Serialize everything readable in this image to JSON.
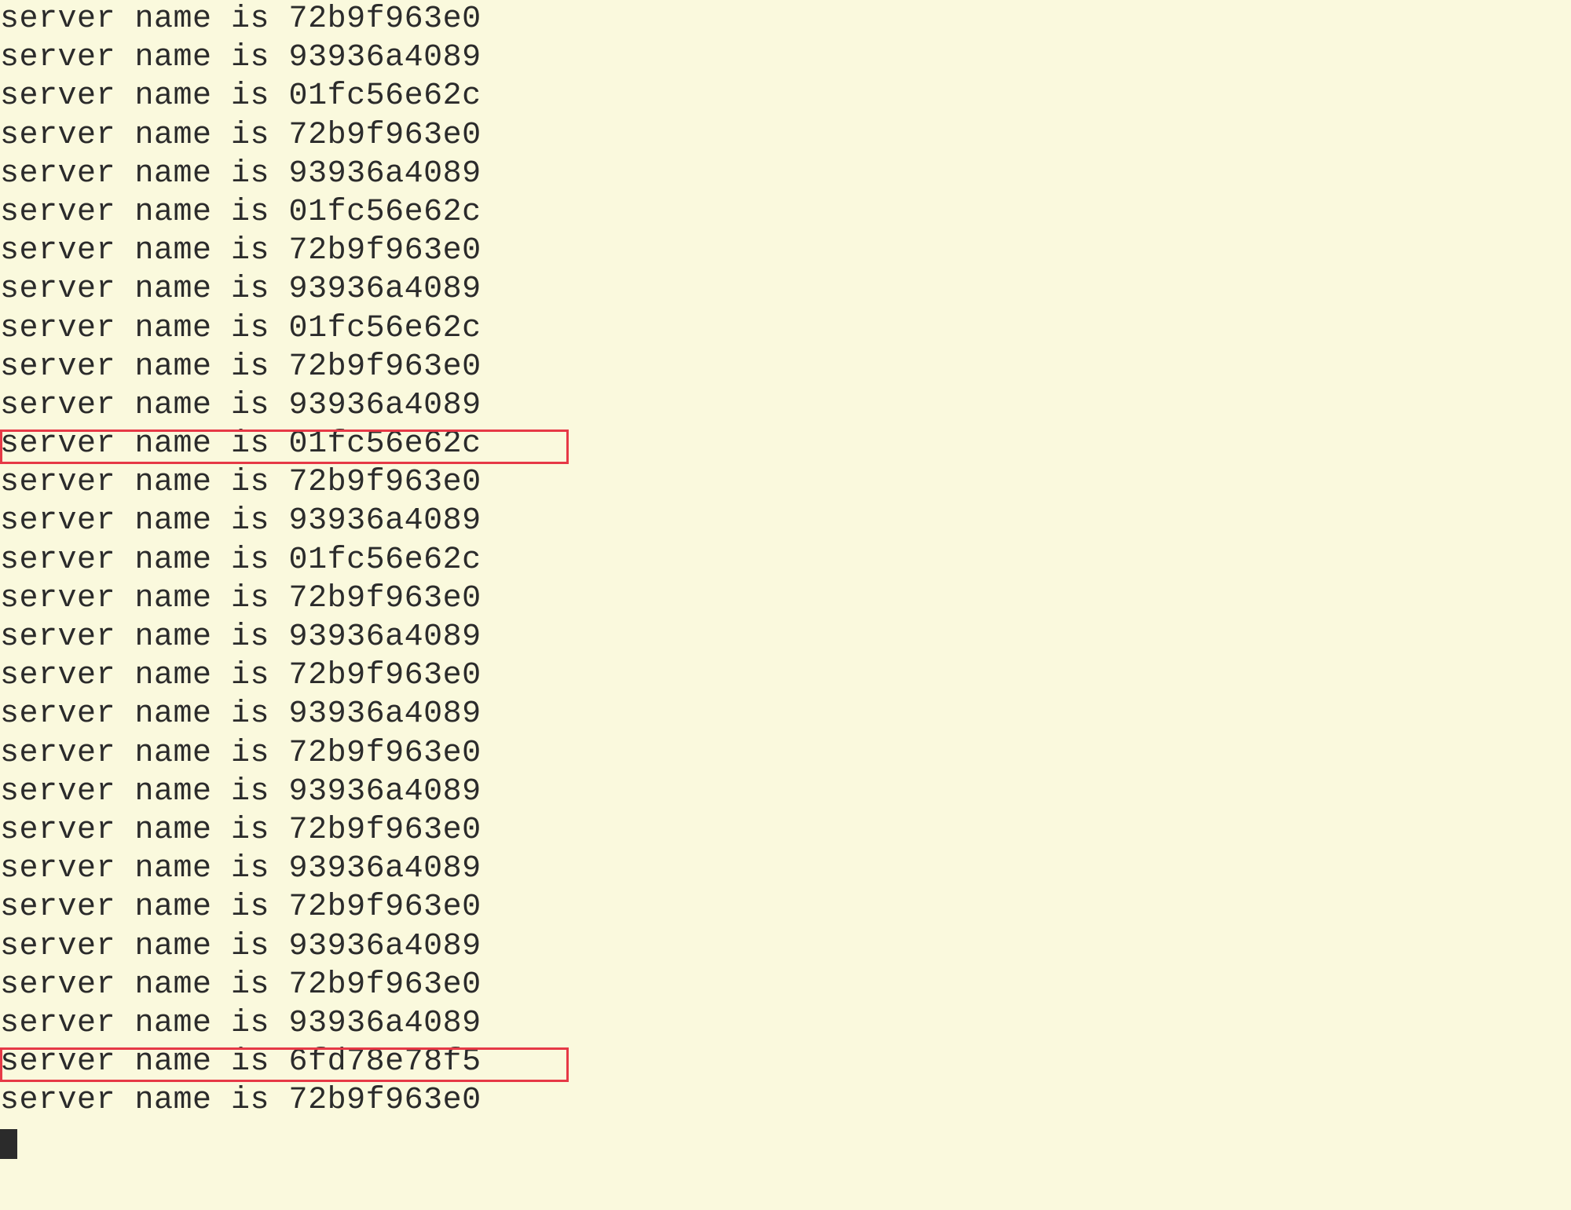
{
  "terminal": {
    "prefix": "server name is ",
    "lines": [
      {
        "id": "72b9f963e0",
        "highlighted": false
      },
      {
        "id": "93936a4089",
        "highlighted": false
      },
      {
        "id": "01fc56e62c",
        "highlighted": false
      },
      {
        "id": "72b9f963e0",
        "highlighted": false
      },
      {
        "id": "93936a4089",
        "highlighted": false
      },
      {
        "id": "01fc56e62c",
        "highlighted": false
      },
      {
        "id": "72b9f963e0",
        "highlighted": false
      },
      {
        "id": "93936a4089",
        "highlighted": false
      },
      {
        "id": "01fc56e62c",
        "highlighted": false
      },
      {
        "id": "72b9f963e0",
        "highlighted": false
      },
      {
        "id": "93936a4089",
        "highlighted": false
      },
      {
        "id": "01fc56e62c",
        "highlighted": true
      },
      {
        "id": "72b9f963e0",
        "highlighted": false
      },
      {
        "id": "93936a4089",
        "highlighted": false
      },
      {
        "id": "01fc56e62c",
        "highlighted": false
      },
      {
        "id": "72b9f963e0",
        "highlighted": false
      },
      {
        "id": "93936a4089",
        "highlighted": false
      },
      {
        "id": "72b9f963e0",
        "highlighted": false
      },
      {
        "id": "93936a4089",
        "highlighted": false
      },
      {
        "id": "72b9f963e0",
        "highlighted": false
      },
      {
        "id": "93936a4089",
        "highlighted": false
      },
      {
        "id": "72b9f963e0",
        "highlighted": false
      },
      {
        "id": "93936a4089",
        "highlighted": false
      },
      {
        "id": "72b9f963e0",
        "highlighted": false
      },
      {
        "id": "93936a4089",
        "highlighted": false
      },
      {
        "id": "72b9f963e0",
        "highlighted": false
      },
      {
        "id": "93936a4089",
        "highlighted": false
      },
      {
        "id": "6fd78e78f5",
        "highlighted": true
      },
      {
        "id": "72b9f963e0",
        "highlighted": false
      }
    ],
    "highlight_color": "#e63946",
    "cursor_visible": true
  }
}
